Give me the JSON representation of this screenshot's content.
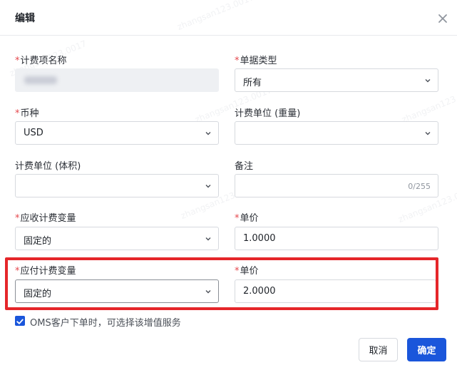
{
  "dialog": {
    "title": "编辑"
  },
  "fields": {
    "fee_item_name": {
      "label": "计费项名称",
      "required": true,
      "value_redacted": true
    },
    "document_type": {
      "label": "单据类型",
      "required": true,
      "value": "所有"
    },
    "currency": {
      "label": "币种",
      "required": true,
      "value": "USD"
    },
    "unit_weight": {
      "label": "计费单位 (重量)",
      "required": false,
      "value": ""
    },
    "unit_volume": {
      "label": "计费单位 (体积)",
      "required": false,
      "value": ""
    },
    "remark": {
      "label": "备注",
      "required": false,
      "value": "",
      "counter": "0/255"
    },
    "receivable_variable": {
      "label": "应收计费变量",
      "required": true,
      "value": "固定的"
    },
    "receivable_price": {
      "label": "单价",
      "required": true,
      "value": "1.0000"
    },
    "payable_variable": {
      "label": "应付计费变量",
      "required": true,
      "value": "固定的"
    },
    "payable_price": {
      "label": "单价",
      "required": true,
      "value": "2.0000"
    }
  },
  "required_mark": "*",
  "oms_option": {
    "label": "OMS客户下单时，可选择该增值服务",
    "checked": true
  },
  "buttons": {
    "cancel": "取消",
    "confirm": "确定"
  },
  "watermark": "zhangsan123.0017",
  "colors": {
    "primary": "#1a56db",
    "required": "#e5484d",
    "highlight": "#e5262a"
  }
}
